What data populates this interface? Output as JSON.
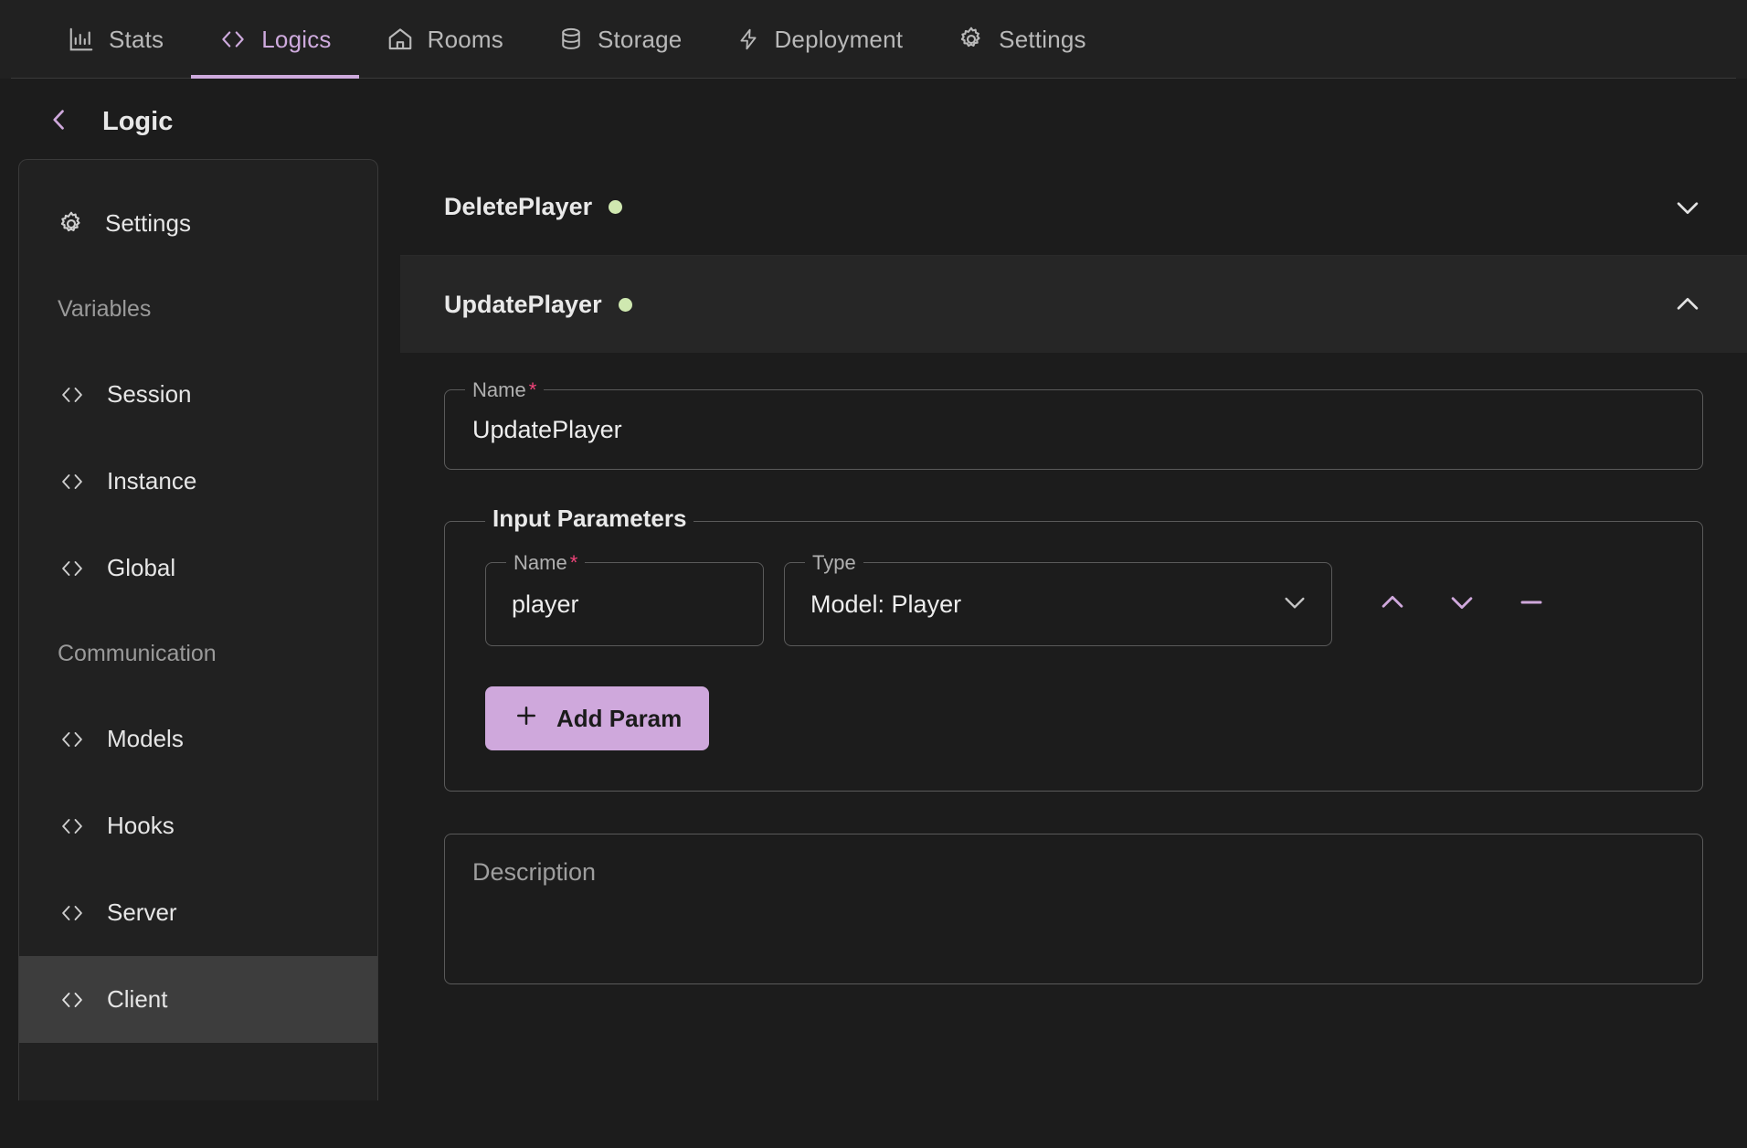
{
  "nav": {
    "tabs": [
      {
        "label": "Stats",
        "icon": "bar-chart-icon",
        "active": false
      },
      {
        "label": "Logics",
        "icon": "code-brackets-icon",
        "active": true
      },
      {
        "label": "Rooms",
        "icon": "home-icon",
        "active": false
      },
      {
        "label": "Storage",
        "icon": "database-icon",
        "active": false
      },
      {
        "label": "Deployment",
        "icon": "lightning-bolt-icon",
        "active": false
      },
      {
        "label": "Settings",
        "icon": "gear-icon",
        "active": false
      }
    ]
  },
  "header": {
    "back_icon": "chevron-left-icon",
    "title": "Logic"
  },
  "sidebar": {
    "items": [
      {
        "type": "item",
        "label": "Settings",
        "icon": "gear-icon",
        "selected": false
      },
      {
        "type": "group",
        "label": "Variables"
      },
      {
        "type": "item",
        "label": "Session",
        "icon": "code-brackets-icon",
        "selected": false
      },
      {
        "type": "item",
        "label": "Instance",
        "icon": "code-brackets-icon",
        "selected": false
      },
      {
        "type": "item",
        "label": "Global",
        "icon": "code-brackets-icon",
        "selected": false
      },
      {
        "type": "group",
        "label": "Communication"
      },
      {
        "type": "item",
        "label": "Models",
        "icon": "code-brackets-icon",
        "selected": false
      },
      {
        "type": "item",
        "label": "Hooks",
        "icon": "code-brackets-icon",
        "selected": false
      },
      {
        "type": "item",
        "label": "Server",
        "icon": "code-brackets-icon",
        "selected": false
      },
      {
        "type": "item",
        "label": "Client",
        "icon": "code-brackets-icon",
        "selected": true
      }
    ]
  },
  "main": {
    "sections": [
      {
        "title": "DeletePlayer",
        "status": "active",
        "expanded": false
      },
      {
        "title": "UpdatePlayer",
        "status": "active",
        "expanded": true
      }
    ],
    "form": {
      "name_label": "Name",
      "name_required": "*",
      "name_value": "UpdatePlayer",
      "params_legend": "Input Parameters",
      "params": [
        {
          "name_label": "Name",
          "name_required": "*",
          "name_value": "player",
          "type_label": "Type",
          "type_value": "Model: Player",
          "move_up_icon": "chevron-up-icon",
          "move_down_icon": "chevron-down-icon",
          "remove_icon": "minus-icon"
        }
      ],
      "add_param_label": "Add Param",
      "add_param_icon": "plus-icon",
      "description_placeholder": "Description"
    }
  },
  "colors": {
    "accent": "#cfa8dc",
    "required": "#f0447a",
    "status_dot": "#cfe8b0",
    "background": "#1c1c1c",
    "panel": "#212121",
    "panel_highlight": "#262626",
    "selected": "#3d3d3d"
  }
}
